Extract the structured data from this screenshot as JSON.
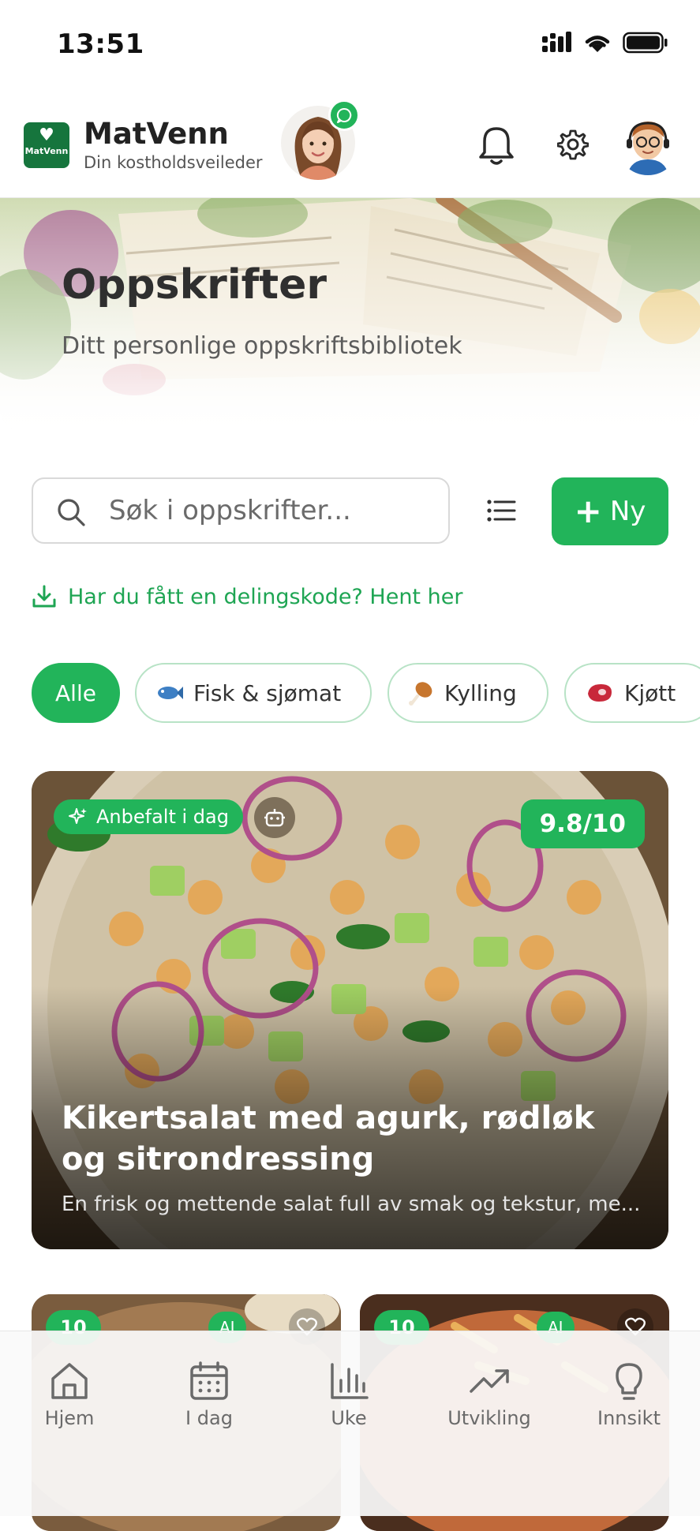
{
  "status_bar": {
    "time": "13:51"
  },
  "header": {
    "app_name": "MatVenn",
    "tagline": "Din kostholdsveileder",
    "logo_text": "MatVenn"
  },
  "hero": {
    "title": "Oppskrifter",
    "subtitle": "Ditt personlige oppskriftsbibliotek"
  },
  "search": {
    "placeholder": "Søk i oppskrifter..."
  },
  "toolbar": {
    "new_label": "Ny"
  },
  "share_link": "Har du fått en delingskode? Hent her",
  "categories": [
    {
      "label": "Alle",
      "active": true
    },
    {
      "label": "Fisk & sjømat",
      "icon": "fish-icon"
    },
    {
      "label": "Kylling",
      "icon": "chicken-leg-icon"
    },
    {
      "label": "Kjøtt",
      "icon": "meat-icon"
    }
  ],
  "featured": {
    "badge": "Anbefalt i dag",
    "score": "9.8/10",
    "title": "Kikertsalat med agurk, rødløk og sitrondressing",
    "description": "En frisk og mettende salat full av smak og tekstur, me..."
  },
  "grid_cards": [
    {
      "score": "10",
      "ai_badge": "AI"
    },
    {
      "score": "10",
      "ai_badge": "AI"
    }
  ],
  "tabs": [
    {
      "label": "Hjem",
      "icon": "home-icon"
    },
    {
      "label": "I dag",
      "icon": "calendar-icon"
    },
    {
      "label": "Uke",
      "icon": "bar-chart-icon"
    },
    {
      "label": "Utvikling",
      "icon": "trending-up-icon"
    },
    {
      "label": "Innsikt",
      "icon": "lightbulb-icon"
    }
  ],
  "colors": {
    "accent": "#22b45a",
    "brand_dark": "#16753d",
    "link": "#1ea553"
  }
}
